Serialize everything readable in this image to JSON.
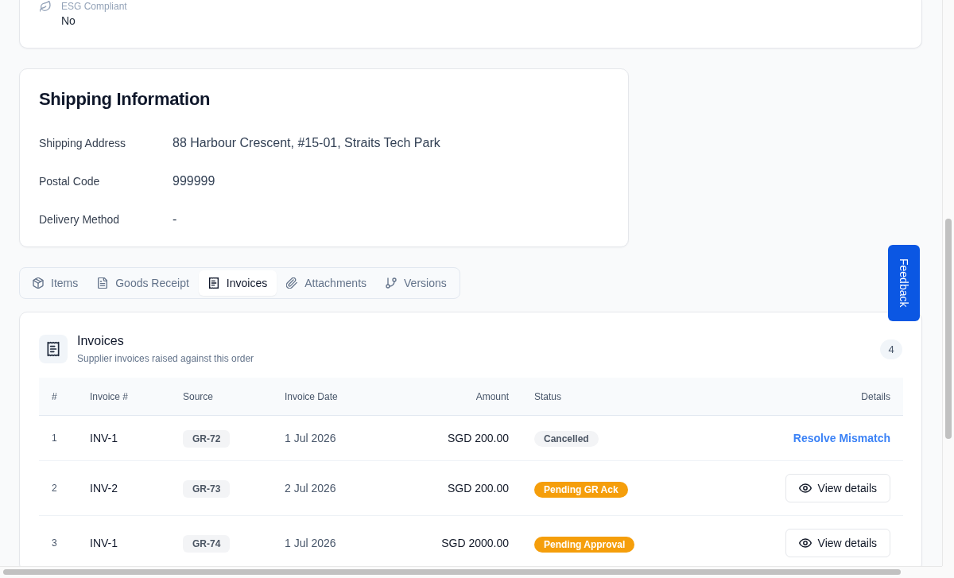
{
  "details_card": {
    "fields": [
      {
        "label": "ESG Compliant",
        "value": "No"
      }
    ]
  },
  "shipping": {
    "title": "Shipping Information",
    "fields": [
      {
        "label": "Shipping Address",
        "value": "88 Harbour Crescent, #15-01, Straits Tech Park"
      },
      {
        "label": "Postal Code",
        "value": "999999"
      },
      {
        "label": "Delivery Method",
        "value": "-"
      }
    ]
  },
  "tabs": [
    {
      "label": "Items",
      "selected": false
    },
    {
      "label": "Goods Receipt",
      "selected": false
    },
    {
      "label": "Invoices",
      "selected": true
    },
    {
      "label": "Attachments",
      "selected": false
    },
    {
      "label": "Versions",
      "selected": false
    }
  ],
  "invoices": {
    "title": "Invoices",
    "subtitle": "Supplier invoices raised against this order",
    "count": "4",
    "columns": [
      "#",
      "Invoice #",
      "Source",
      "Invoice Date",
      "Amount",
      "Status",
      "Details"
    ],
    "rows": [
      {
        "index": "1",
        "invoice": "INV-1",
        "source": "GR-72",
        "date": "1 Jul 2026",
        "amount": "SGD 200.00",
        "status": {
          "label": "Cancelled",
          "kind": "neutral"
        },
        "details": {
          "label": "Resolve Mismatch",
          "kind": "link"
        }
      },
      {
        "index": "2",
        "invoice": "INV-2",
        "source": "GR-73",
        "date": "2 Jul 2026",
        "amount": "SGD 200.00",
        "status": {
          "label": "Pending GR Ack",
          "kind": "warning"
        },
        "details": {
          "label": "View details",
          "kind": "button"
        }
      },
      {
        "index": "3",
        "invoice": "INV-1",
        "source": "GR-74",
        "date": "1 Jul 2026",
        "amount": "SGD 2000.00",
        "status": {
          "label": "Pending Approval",
          "kind": "warning"
        },
        "details": {
          "label": "View details",
          "kind": "button"
        }
      }
    ]
  },
  "feedback": {
    "label": "Feedback"
  }
}
